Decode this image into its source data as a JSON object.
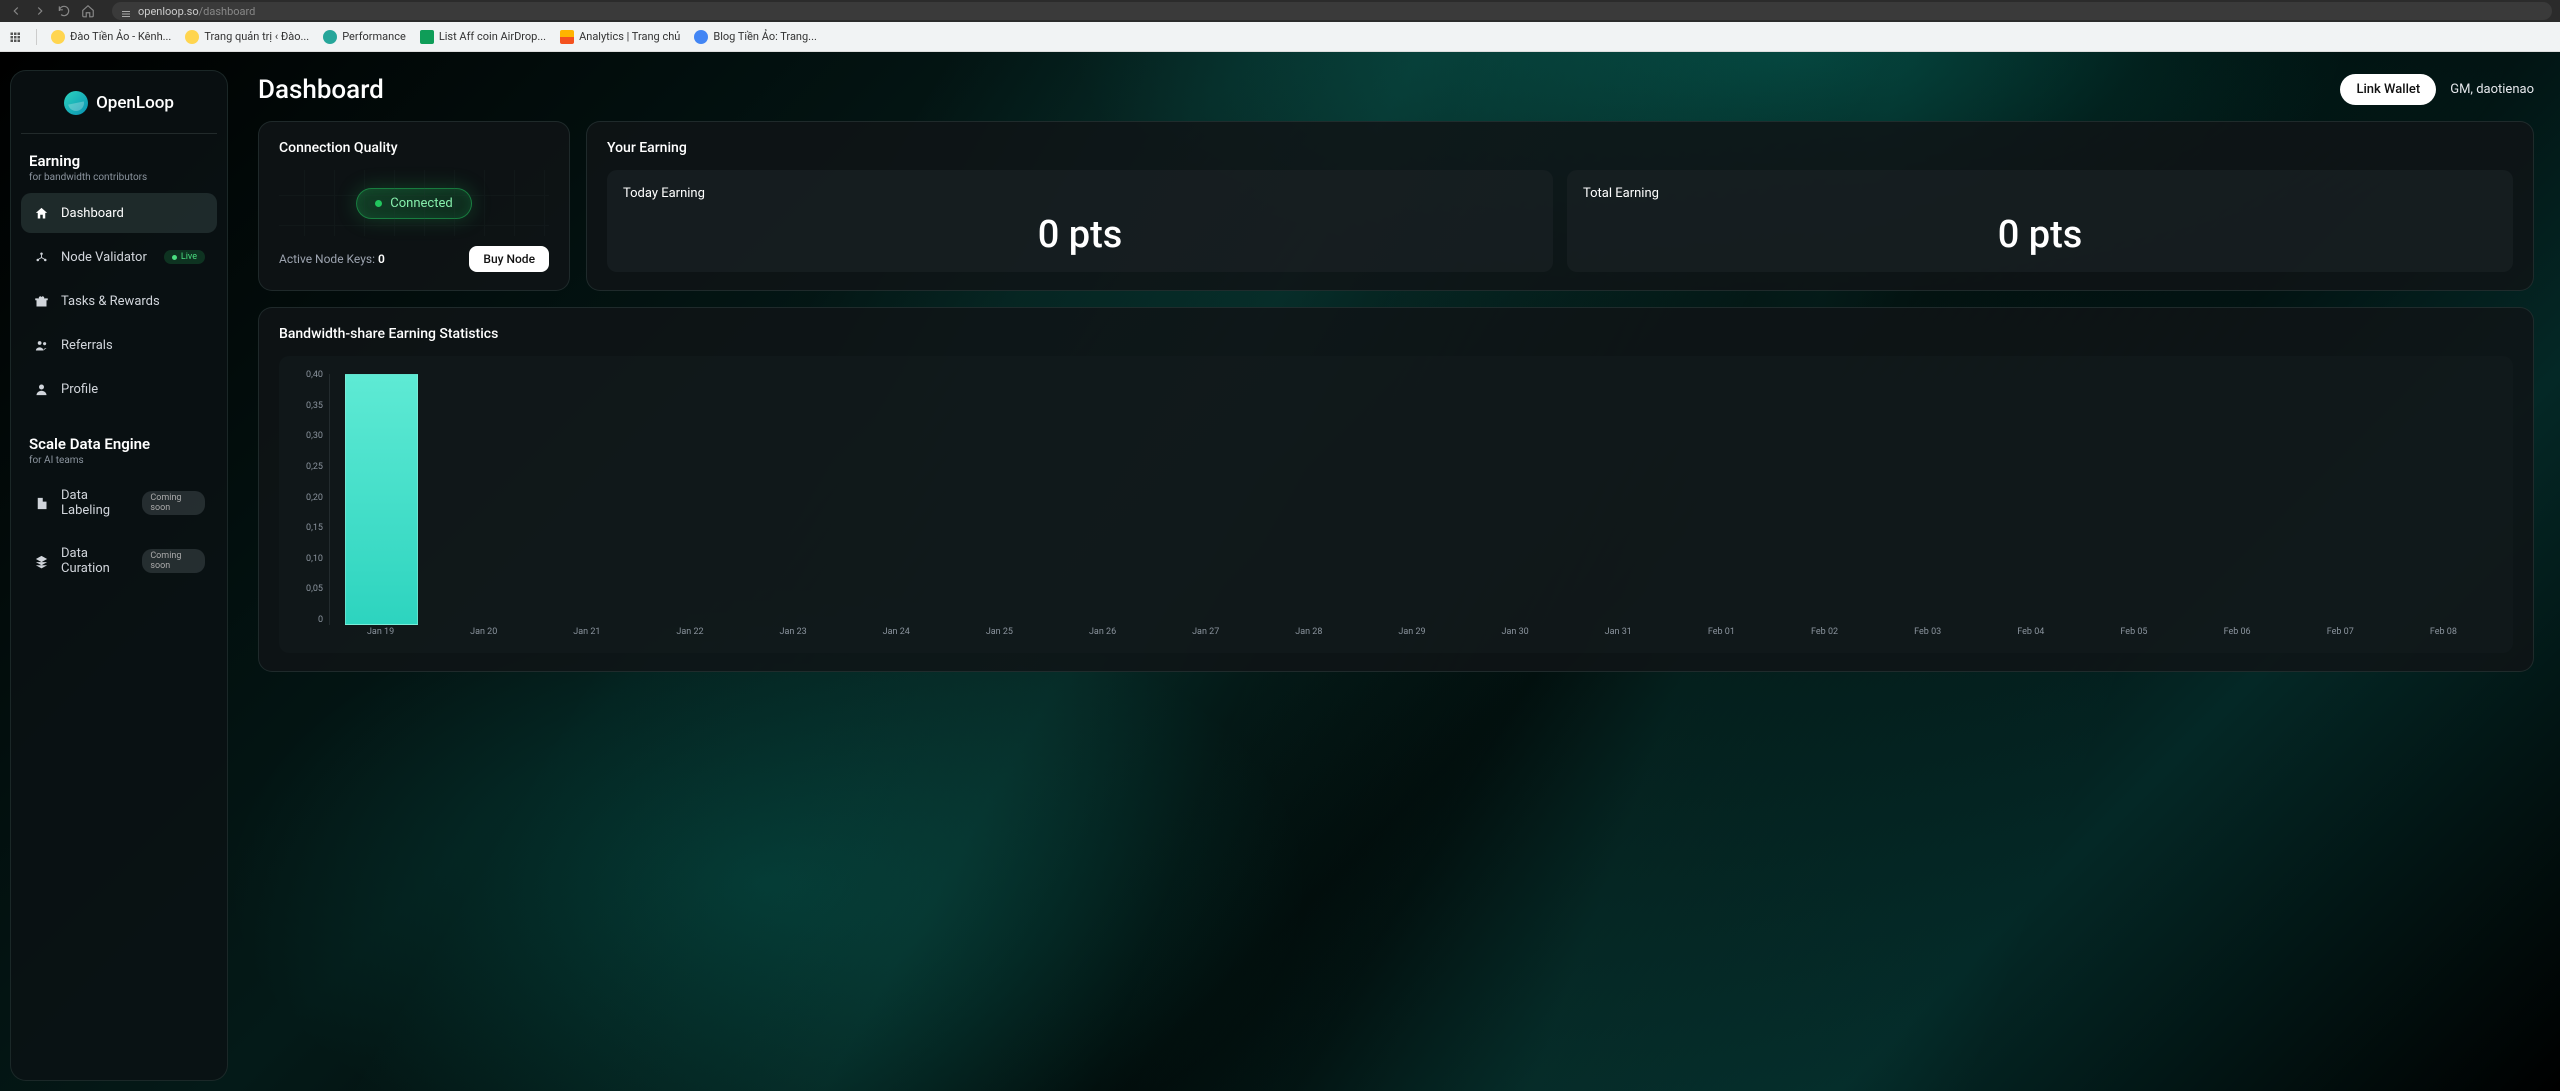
{
  "browser": {
    "url_domain": "openloop.so",
    "url_path": "/dashboard",
    "bookmarks": [
      {
        "label": "Đào Tiền Ảo - Kênh...",
        "iconClass": "sun"
      },
      {
        "label": "Trang quản trị ‹ Đào...",
        "iconClass": "sun"
      },
      {
        "label": "Performance",
        "iconClass": "teal"
      },
      {
        "label": "List Aff coin AirDrop...",
        "iconClass": "green"
      },
      {
        "label": "Analytics | Trang chủ",
        "iconClass": "orange"
      },
      {
        "label": "Blog Tiền Ảo: Trang...",
        "iconClass": "blue"
      }
    ]
  },
  "sidebar": {
    "brand": "OpenLoop",
    "section1": {
      "title": "Earning",
      "sub": "for bandwidth contributors"
    },
    "items1": [
      {
        "label": "Dashboard"
      },
      {
        "label": "Node Validator",
        "badge": "Live",
        "badgeClass": "live"
      },
      {
        "label": "Tasks & Rewards"
      },
      {
        "label": "Referrals"
      },
      {
        "label": "Profile"
      }
    ],
    "section2": {
      "title": "Scale Data Engine",
      "sub": "for AI teams"
    },
    "items2": [
      {
        "label": "Data Labeling",
        "badge": "Coming soon",
        "badgeClass": "soon"
      },
      {
        "label": "Data Curation",
        "badge": "Coming soon",
        "badgeClass": "soon"
      }
    ]
  },
  "header": {
    "title": "Dashboard",
    "link_wallet": "Link Wallet",
    "greeting": "GM, daotienao"
  },
  "connection": {
    "title": "Connection Quality",
    "status": "Connected",
    "keys_label": "Active Node Keys: ",
    "keys_value": "0",
    "buy": "Buy Node"
  },
  "earning": {
    "title": "Your Earning",
    "today_label": "Today Earning",
    "today_value": "0 pts",
    "total_label": "Total Earning",
    "total_value": "0 pts"
  },
  "stats": {
    "title": "Bandwidth-share Earning Statistics"
  },
  "chart_data": {
    "type": "bar",
    "title": "Bandwidth-share Earning Statistics",
    "xlabel": "",
    "ylabel": "",
    "ylim": [
      0,
      0.4
    ],
    "y_ticks": [
      "0,40",
      "0,35",
      "0,30",
      "0,25",
      "0,20",
      "0,15",
      "0,10",
      "0,05",
      "0"
    ],
    "categories": [
      "Jan 19",
      "Jan 20",
      "Jan 21",
      "Jan 22",
      "Jan 23",
      "Jan 24",
      "Jan 25",
      "Jan 26",
      "Jan 27",
      "Jan 28",
      "Jan 29",
      "Jan 30",
      "Jan 31",
      "Feb 01",
      "Feb 02",
      "Feb 03",
      "Feb 04",
      "Feb 05",
      "Feb 06",
      "Feb 07",
      "Feb 08"
    ],
    "values": [
      0.4,
      0,
      0,
      0,
      0,
      0,
      0,
      0,
      0,
      0,
      0,
      0,
      0,
      0,
      0,
      0,
      0,
      0,
      0,
      0,
      0
    ]
  }
}
